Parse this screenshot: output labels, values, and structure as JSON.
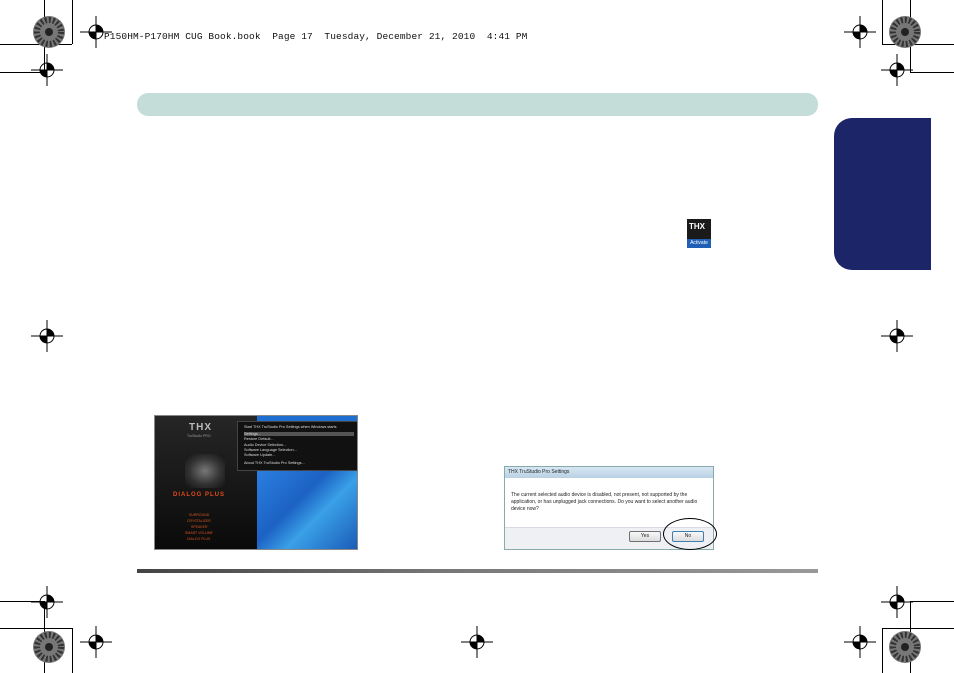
{
  "header": {
    "file_line": "P150HM-P170HM CUG Book.book  Page 17  Tuesday, December 21, 2010  4:41 PM"
  },
  "thx_icon": {
    "logo_text": "THX",
    "caption": "Activate"
  },
  "screenshot_menu": {
    "app_logo": "THX",
    "app_subtitle": "TruStudio PRO",
    "mode_label": "DIALOG PLUS",
    "panel_items": [
      "SURROUND",
      "CRYSTALIZER",
      "SPEAKER",
      "SMART VOLUME",
      "DIALOG PLUS"
    ],
    "menu_items": [
      "Start THX TruStudio Pro Settings when Windows starts",
      "Settings...",
      "Restore Default...",
      "Audio Device Selection...",
      "Software Language Selection...",
      "Software Update...",
      "About THX TruStudio Pro Settings..."
    ]
  },
  "screenshot_dialog": {
    "title": "THX TruStudio Pro Settings",
    "message": "The current selected audio device is disabled, not present, not supported by the application, or has unplugged jack connections. Do you want to select another audio device now?",
    "yes_label": "Yes",
    "no_label": "No"
  }
}
